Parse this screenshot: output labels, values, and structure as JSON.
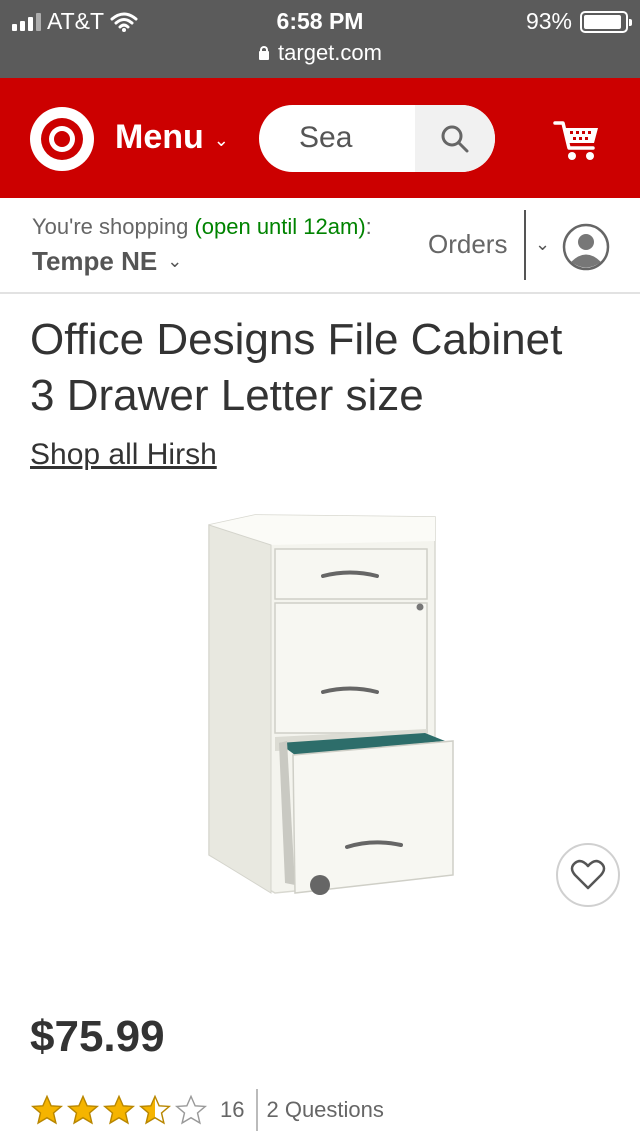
{
  "status_bar": {
    "carrier": "AT&T",
    "time": "6:58 PM",
    "battery_percent": "93%",
    "battery_level": 0.93,
    "url": "target.com"
  },
  "header": {
    "menu_label": "Menu",
    "search_placeholder": "Sea",
    "brand_color": "#cc0000"
  },
  "store_bar": {
    "shopping_prefix": "You're shopping",
    "open_hours": "(open until 12am)",
    "colon": ":",
    "store_name": "Tempe NE",
    "orders_label": "Orders"
  },
  "product": {
    "title_line1": "Office Designs File Cabinet",
    "title_line2": "3 Drawer Letter size",
    "shop_all_link": "Shop all Hirsh",
    "price": "$75.99",
    "rating_value": 3.5,
    "rating_max": 5,
    "review_count": "16",
    "questions_label": "2 Questions"
  },
  "icons": {
    "logo": "target-bullseye-icon",
    "search": "magnifier-icon",
    "cart": "cart-icon",
    "account": "user-avatar-icon",
    "favorite": "heart-icon"
  }
}
